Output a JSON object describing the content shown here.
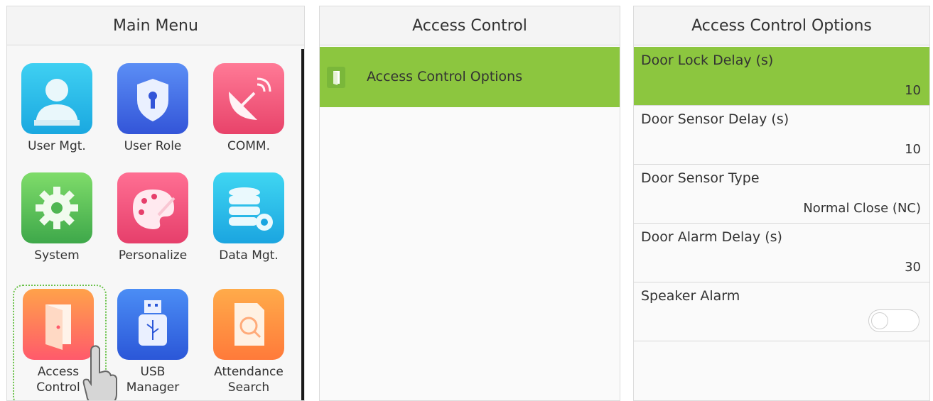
{
  "main_menu": {
    "title": "Main Menu",
    "items": [
      {
        "label": "User Mgt.",
        "icon": "user-icon"
      },
      {
        "label": "User Role",
        "icon": "shield-icon"
      },
      {
        "label": "COMM.",
        "icon": "satellite-dish-icon"
      },
      {
        "label": "System",
        "icon": "gear-icon"
      },
      {
        "label": "Personalize",
        "icon": "palette-icon"
      },
      {
        "label": "Data Mgt.",
        "icon": "database-icon"
      },
      {
        "label_line1": "Access",
        "label_line2": "Control",
        "icon": "door-icon"
      },
      {
        "label_line1": "USB",
        "label_line2": "Manager",
        "icon": "usb-icon"
      },
      {
        "label_line1": "Attendance",
        "label_line2": "Search",
        "icon": "search-document-icon"
      }
    ]
  },
  "access_control": {
    "title": "Access Control",
    "items": [
      {
        "label": "Access Control Options",
        "icon": "door-icon"
      }
    ]
  },
  "options": {
    "title": "Access Control Options",
    "rows": [
      {
        "name": "Door Lock Delay (s)",
        "value": "10"
      },
      {
        "name": "Door Sensor Delay (s)",
        "value": "10"
      },
      {
        "name": "Door Sensor Type",
        "value": "Normal Close (NC)"
      },
      {
        "name": "Door Alarm Delay (s)",
        "value": "30"
      },
      {
        "name": "Speaker Alarm",
        "toggle_on": false
      }
    ]
  },
  "colors": {
    "selection": "#8cc63f"
  }
}
